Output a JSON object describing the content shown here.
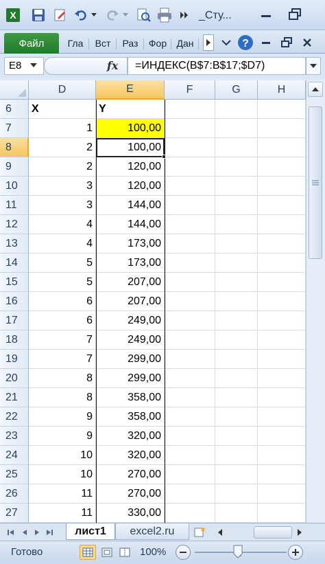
{
  "titlebar": {
    "title": "_Сту",
    "title_ellipsis": "...",
    "icons": [
      "excel-logo-icon",
      "save-icon",
      "properties-icon",
      "undo-icon",
      "redo-icon",
      "print-preview-icon",
      "print-icon",
      "more-icon",
      "minimize-icon",
      "restore-icon"
    ]
  },
  "ribbon": {
    "file_label": "Файл",
    "tabs": [
      "Гла",
      "Вст",
      "Раз",
      "Фор",
      "Дан"
    ]
  },
  "formula_bar": {
    "name_box": "E8",
    "fx": "fx",
    "formula": "=ИНДЕКС(B$7:B$17;$D7)"
  },
  "grid": {
    "columns": [
      "D",
      "E",
      "F",
      "G",
      "H"
    ],
    "selected_column": "E",
    "header_row": {
      "row": "6",
      "D": "X",
      "E": "Y"
    },
    "rows": [
      {
        "row": "7",
        "D": "1",
        "E": "100,00"
      },
      {
        "row": "8",
        "D": "2",
        "E": "100,00"
      },
      {
        "row": "9",
        "D": "2",
        "E": "120,00"
      },
      {
        "row": "10",
        "D": "3",
        "E": "120,00"
      },
      {
        "row": "11",
        "D": "3",
        "E": "144,00"
      },
      {
        "row": "12",
        "D": "4",
        "E": "144,00"
      },
      {
        "row": "13",
        "D": "4",
        "E": "173,00"
      },
      {
        "row": "14",
        "D": "5",
        "E": "173,00"
      },
      {
        "row": "15",
        "D": "5",
        "E": "207,00"
      },
      {
        "row": "16",
        "D": "6",
        "E": "207,00"
      },
      {
        "row": "17",
        "D": "6",
        "E": "249,00"
      },
      {
        "row": "18",
        "D": "7",
        "E": "249,00"
      },
      {
        "row": "19",
        "D": "7",
        "E": "299,00"
      },
      {
        "row": "20",
        "D": "8",
        "E": "299,00"
      },
      {
        "row": "21",
        "D": "8",
        "E": "358,00"
      },
      {
        "row": "22",
        "D": "9",
        "E": "358,00"
      },
      {
        "row": "23",
        "D": "9",
        "E": "320,00"
      },
      {
        "row": "24",
        "D": "10",
        "E": "320,00"
      },
      {
        "row": "25",
        "D": "10",
        "E": "270,00"
      },
      {
        "row": "26",
        "D": "11",
        "E": "270,00"
      },
      {
        "row": "27",
        "D": "11",
        "E": "330,00"
      }
    ],
    "selected_row": "8",
    "highlight_color": "#ffff00"
  },
  "sheets": {
    "tabs": [
      "лист1",
      "excel2.ru"
    ],
    "active": "лист1"
  },
  "statusbar": {
    "status": "Готово",
    "zoom": "100%"
  }
}
